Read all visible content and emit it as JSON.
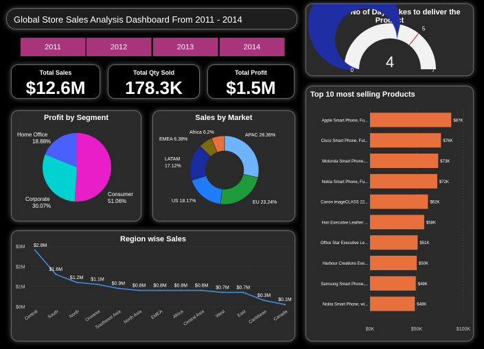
{
  "dashboard": {
    "title": "Global Store Sales Analysis Dashboard From 2011 - 2014"
  },
  "years": [
    "2011",
    "2012",
    "2013",
    "2014"
  ],
  "kpis": {
    "sales": {
      "label": "Total Sales",
      "value": "$12.6M"
    },
    "qty": {
      "label": "Total Qty Sold",
      "value": "178.3K"
    },
    "profit": {
      "label": "Total Profit",
      "value": "$1.5M"
    }
  },
  "colors": {
    "accent": "#a8357c",
    "gauge_fill": "#1f2fa3",
    "gauge_bg": "#f2f2f2",
    "bar": "#e8703c",
    "line": "#3b8fe0"
  },
  "chart_data": [
    {
      "type": "gauge",
      "title": "Average No of Days takes to deliver the Product",
      "value": 4,
      "target": 5,
      "min": 0,
      "max": 7,
      "value_label": "4",
      "target_label": "5",
      "min_label": "0",
      "max_label": "7"
    },
    {
      "type": "pie",
      "title": "Profit by Segment",
      "slices": [
        {
          "name": "Consumer",
          "label": "51.06%",
          "value": 51.06,
          "color": "#e81ec8"
        },
        {
          "name": "Corporate",
          "label": "30.07%",
          "value": 30.07,
          "color": "#00d2d2"
        },
        {
          "name": "Home Office",
          "label": "18.88%",
          "value": 18.88,
          "color": "#4960ff"
        }
      ]
    },
    {
      "type": "donut",
      "title": "Sales by Market",
      "slices": [
        {
          "name": "APAC",
          "label": "28.36%",
          "value": 28.36,
          "color": "#6fb4ff"
        },
        {
          "name": "EU",
          "label": "23.24%",
          "value": 23.24,
          "color": "#1e9c3c"
        },
        {
          "name": "US",
          "label": "18.17%",
          "value": 18.17,
          "color": "#1e7dff"
        },
        {
          "name": "LATAM",
          "label": "17.12%",
          "value": 17.12,
          "color": "#1a2b9e"
        },
        {
          "name": "EMEA",
          "label": "6.38%",
          "value": 6.38,
          "color": "#7a6a10"
        },
        {
          "name": "Africa",
          "label": "6.2%",
          "value": 6.2,
          "color": "#e8703c"
        }
      ]
    },
    {
      "type": "line",
      "title": "Region wise Sales",
      "categories": [
        "Central",
        "South",
        "North",
        "Oceania",
        "Southeast Asia",
        "North Asia",
        "EMEA",
        "Africa",
        "Central Asia",
        "West",
        "East",
        "Caribbean",
        "Canada"
      ],
      "values": [
        2.8,
        1.6,
        1.2,
        1.1,
        0.9,
        0.8,
        0.8,
        0.8,
        0.8,
        0.7,
        0.7,
        0.3,
        0.1
      ],
      "labels": [
        "$2.8M",
        "$1.6M",
        "$1.2M",
        "$1.1M",
        "$0.9M",
        "$0.8M",
        "$0.8M",
        "$0.8M",
        "$0.8M",
        "$0.7M",
        "$0.7M",
        "$0.3M",
        "$0.1M"
      ],
      "yticks": [
        "$0M",
        "$1M",
        "$2M",
        "$3M"
      ],
      "ylim": [
        0,
        3
      ]
    },
    {
      "type": "bar",
      "orientation": "horizontal",
      "title": "Top 10 most selling Products",
      "categories": [
        "Apple Smart Phone, Fu...",
        "Cisco Smart Phone, Ful...",
        "Motorola Smart Phone,...",
        "Nokia Smart Phone, Fu...",
        "Canon imageCLASS 22...",
        "Hon Executive Leather ...",
        "Office Star Executive Le...",
        "Harbour Creations Exe...",
        "Samsung Smart Phone,...",
        "Nokia Smart Phone, wi..."
      ],
      "values": [
        87,
        76,
        73,
        72,
        62,
        58,
        51,
        50,
        49,
        48
      ],
      "labels": [
        "$87K",
        "$76K",
        "$73K",
        "$72K",
        "$62K",
        "$58K",
        "$51K",
        "$50K",
        "$49K",
        "$48K"
      ],
      "xticks": [
        "$0K",
        "$50K",
        "$100K"
      ],
      "xlim": [
        0,
        100
      ]
    }
  ]
}
